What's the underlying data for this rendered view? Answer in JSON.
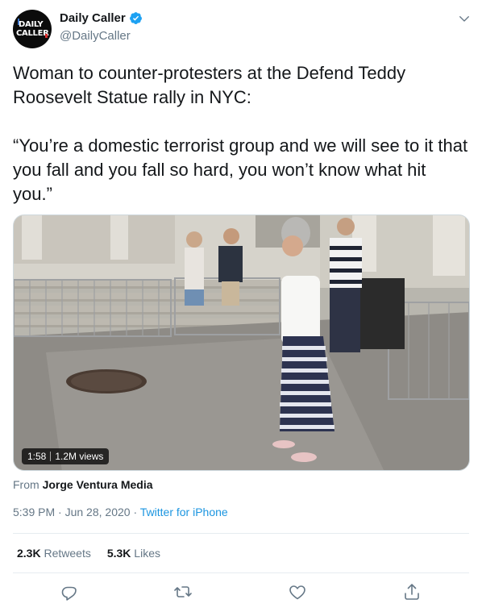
{
  "author": {
    "display_name": "Daily Caller",
    "handle": "@DailyCaller",
    "avatar_text_line1": "DAILY",
    "avatar_text_line2": "CALLER"
  },
  "tweet": {
    "text": "Woman to counter-protesters at the Defend Teddy Roosevelt Statue rally in NYC:\n\n“You’re a domestic terrorist group and we will see to it that you fall and you fall so hard, you won’t know what hit you.”"
  },
  "media": {
    "duration": "1:58",
    "views": "1.2M views"
  },
  "source": {
    "prefix": "From",
    "name": "Jorge Ventura Media"
  },
  "meta": {
    "time": "5:39 PM",
    "date": "Jun 28, 2020",
    "separator": "·",
    "client": "Twitter for iPhone"
  },
  "stats": {
    "retweets_count": "2.3K",
    "retweets_label": "Retweets",
    "likes_count": "5.3K",
    "likes_label": "Likes"
  },
  "icons": {
    "verified": "verified-badge-icon",
    "caret": "chevron-down-icon",
    "reply": "reply-icon",
    "retweet": "retweet-icon",
    "like": "heart-icon",
    "share": "share-icon"
  },
  "colors": {
    "accent": "#1b95e0",
    "verified": "#1da1f2",
    "secondary_text": "#657786"
  }
}
